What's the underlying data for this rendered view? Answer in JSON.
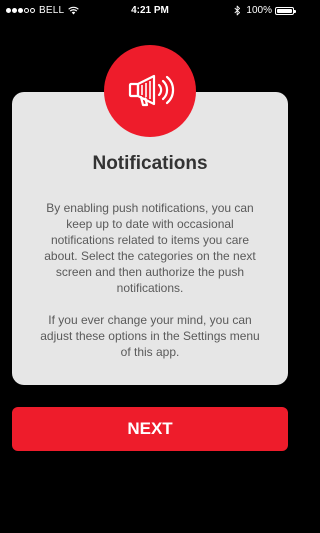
{
  "status_bar": {
    "signal_bars_filled": 3,
    "signal_bars_total": 5,
    "carrier": "BELL",
    "time": "4:21 PM",
    "battery_percent": "100%",
    "battery_level": 1.0,
    "icons": [
      "signal-dots-icon",
      "wifi-icon",
      "bluetooth-icon",
      "battery-icon"
    ]
  },
  "prompt": {
    "icon": "megaphone-icon",
    "title": "Notifications",
    "body_paragraph_1": "By enabling push notifications, you can keep up to date with occasional notifications related to items you care about. Select the categories on the next screen and then authorize the push notifications.",
    "body_paragraph_2": "If you ever change your mind, you can adjust these options in the Settings menu of this app."
  },
  "actions": {
    "next_label": "NEXT"
  },
  "colors": {
    "background": "#000000",
    "card": "#e6e6e6",
    "accent": "#ee1c2b",
    "title_text": "#333333",
    "body_text": "#5a5a5a"
  }
}
